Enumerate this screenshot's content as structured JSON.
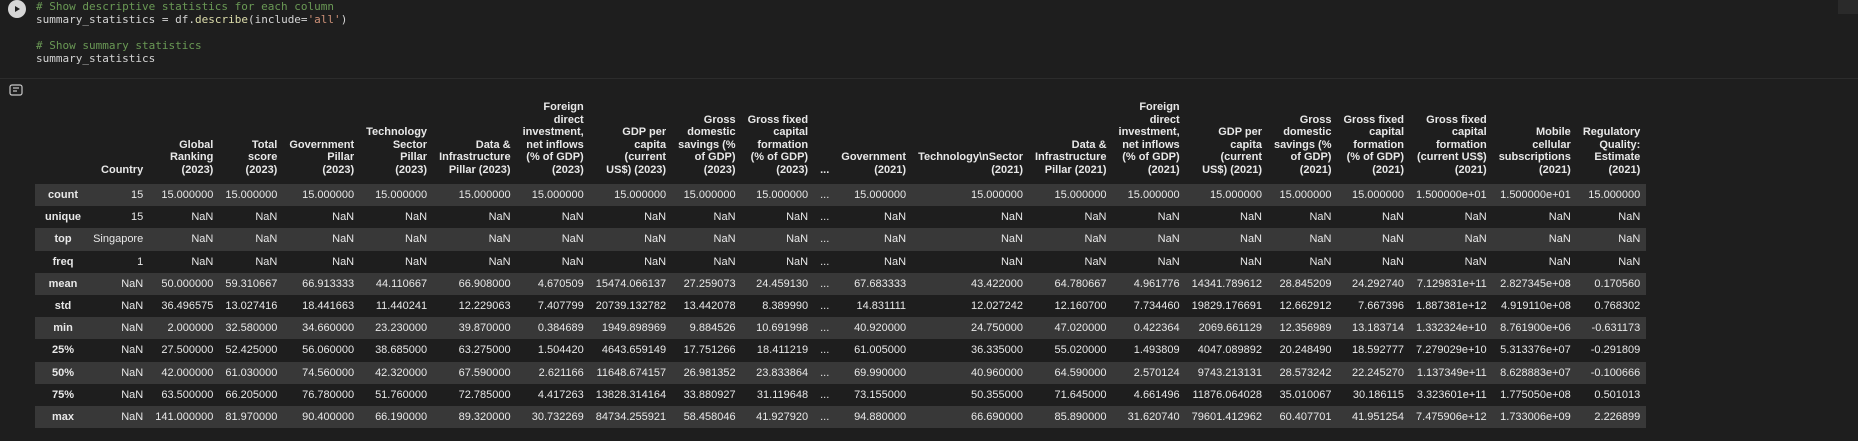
{
  "code": {
    "line1": "# Show descriptive statistics for each column",
    "line2_var": "summary_statistics",
    "line2_eq": " = df.",
    "line2_fn": "describe",
    "line2_open": "(include=",
    "line2_str": "'all'",
    "line2_close": ")",
    "line4": "# Show summary statistics",
    "line5": "summary_statistics"
  },
  "table": {
    "columns": [
      "",
      "Country",
      "Global\nRanking\n(2023)",
      "Total\nscore\n(2023)",
      "Government\nPillar\n(2023)",
      "Technology\nSector\nPillar\n(2023)",
      "Data &\nInfrastructure\nPillar (2023)",
      "Foreign\ndirect\ninvestment,\nnet inflows\n(% of GDP)\n(2023)",
      "GDP per\ncapita\n(current\nUS$) (2023)",
      "Gross\ndomestic\nsavings (%\nof GDP)\n(2023)",
      "Gross fixed\ncapital\nformation\n(% of GDP)\n(2023)",
      "...",
      "Government\n(2021)",
      "Technology\\nSector\n(2021)",
      "Data &\nInfrastructure\nPillar (2021)",
      "Foreign\ndirect\ninvestment,\nnet inflows\n(% of GDP)\n(2021)",
      "GDP per\ncapita\n(current\nUS$) (2021)",
      "Gross\ndomestic\nsavings (%\nof GDP)\n(2021)",
      "Gross fixed\ncapital\nformation\n(% of GDP)\n(2021)",
      "Gross fixed\ncapital\nformation\n(current US$)\n(2021)",
      "Mobile\ncellular\nsubscriptions\n(2021)",
      "Regulatory\nQuality:\nEstimate\n(2021)"
    ],
    "rows": [
      [
        "count",
        "15",
        "15.000000",
        "15.000000",
        "15.000000",
        "15.000000",
        "15.000000",
        "15.000000",
        "15.000000",
        "15.000000",
        "15.000000",
        "...",
        "15.000000",
        "15.000000",
        "15.000000",
        "15.000000",
        "15.000000",
        "15.000000",
        "15.000000",
        "1.500000e+01",
        "1.500000e+01",
        "15.000000"
      ],
      [
        "unique",
        "15",
        "NaN",
        "NaN",
        "NaN",
        "NaN",
        "NaN",
        "NaN",
        "NaN",
        "NaN",
        "NaN",
        "...",
        "NaN",
        "NaN",
        "NaN",
        "NaN",
        "NaN",
        "NaN",
        "NaN",
        "NaN",
        "NaN",
        "NaN"
      ],
      [
        "top",
        "Singapore",
        "NaN",
        "NaN",
        "NaN",
        "NaN",
        "NaN",
        "NaN",
        "NaN",
        "NaN",
        "NaN",
        "...",
        "NaN",
        "NaN",
        "NaN",
        "NaN",
        "NaN",
        "NaN",
        "NaN",
        "NaN",
        "NaN",
        "NaN"
      ],
      [
        "freq",
        "1",
        "NaN",
        "NaN",
        "NaN",
        "NaN",
        "NaN",
        "NaN",
        "NaN",
        "NaN",
        "NaN",
        "...",
        "NaN",
        "NaN",
        "NaN",
        "NaN",
        "NaN",
        "NaN",
        "NaN",
        "NaN",
        "NaN",
        "NaN"
      ],
      [
        "mean",
        "NaN",
        "50.000000",
        "59.310667",
        "66.913333",
        "44.110667",
        "66.908000",
        "4.670509",
        "15474.066137",
        "27.259073",
        "24.459130",
        "...",
        "67.683333",
        "43.422000",
        "64.780667",
        "4.961776",
        "14341.789612",
        "28.845209",
        "24.292740",
        "7.129831e+11",
        "2.827345e+08",
        "0.170560"
      ],
      [
        "std",
        "NaN",
        "36.496575",
        "13.027416",
        "18.441663",
        "11.440241",
        "12.229063",
        "7.407799",
        "20739.132782",
        "13.442078",
        "8.389990",
        "...",
        "14.831111",
        "12.027242",
        "12.160700",
        "7.734460",
        "19829.176691",
        "12.662912",
        "7.667396",
        "1.887381e+12",
        "4.919110e+08",
        "0.768302"
      ],
      [
        "min",
        "NaN",
        "2.000000",
        "32.580000",
        "34.660000",
        "23.230000",
        "39.870000",
        "0.384689",
        "1949.898969",
        "9.884526",
        "10.691998",
        "...",
        "40.920000",
        "24.750000",
        "47.020000",
        "0.422364",
        "2069.661129",
        "12.356989",
        "13.183714",
        "1.332324e+10",
        "8.761900e+06",
        "-0.631173"
      ],
      [
        "25%",
        "NaN",
        "27.500000",
        "52.425000",
        "56.060000",
        "38.685000",
        "63.275000",
        "1.504420",
        "4643.659149",
        "17.751266",
        "18.411219",
        "...",
        "61.005000",
        "36.335000",
        "55.020000",
        "1.493809",
        "4047.089892",
        "20.248490",
        "18.592777",
        "7.279029e+10",
        "5.313376e+07",
        "-0.291809"
      ],
      [
        "50%",
        "NaN",
        "42.000000",
        "61.030000",
        "74.560000",
        "42.320000",
        "67.590000",
        "2.621166",
        "11648.674157",
        "26.981352",
        "23.833864",
        "...",
        "69.990000",
        "40.960000",
        "64.590000",
        "2.570124",
        "9743.213131",
        "28.573242",
        "22.245270",
        "1.137349e+11",
        "8.628883e+07",
        "-0.100666"
      ],
      [
        "75%",
        "NaN",
        "63.500000",
        "66.205000",
        "76.780000",
        "51.760000",
        "72.785000",
        "4.417263",
        "13828.314164",
        "33.880927",
        "31.119648",
        "...",
        "73.155000",
        "50.355000",
        "71.645000",
        "4.661496",
        "11876.064028",
        "35.010067",
        "30.186115",
        "3.323601e+11",
        "1.775050e+08",
        "0.501013"
      ],
      [
        "max",
        "NaN",
        "141.000000",
        "81.970000",
        "90.400000",
        "66.190000",
        "89.320000",
        "30.732269",
        "84734.255921",
        "58.458046",
        "41.927920",
        "...",
        "94.880000",
        "66.690000",
        "85.890000",
        "31.620740",
        "79601.412962",
        "60.407701",
        "41.951254",
        "7.475906e+12",
        "1.733006e+09",
        "2.226899"
      ]
    ]
  },
  "icons": {
    "run": "play-icon",
    "output": "output-options-icon"
  }
}
